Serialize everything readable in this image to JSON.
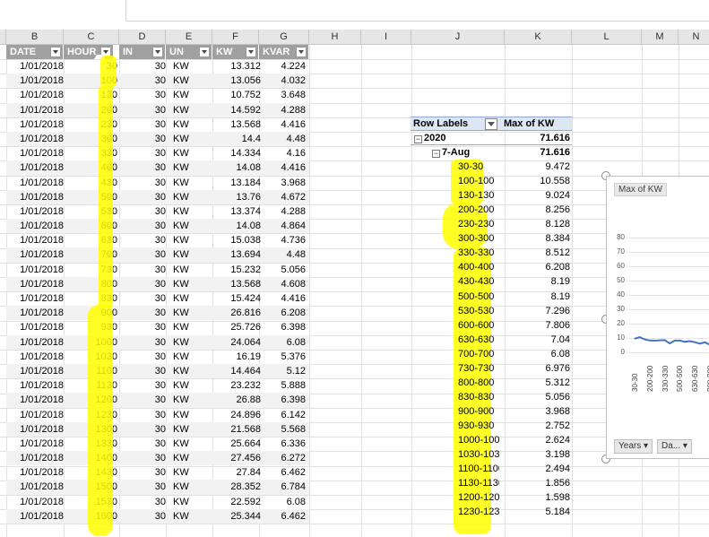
{
  "colors": {
    "header_gray": "#a0a0a0",
    "highlight": "#ffff00",
    "pivot_header": "#dde6f5",
    "line": "#4472c4"
  },
  "columns": [
    "B",
    "C",
    "D",
    "E",
    "F",
    "G",
    "H",
    "I",
    "J",
    "K",
    "L",
    "M",
    "N"
  ],
  "table": {
    "headers": [
      "DATE",
      "HOUR",
      "IN",
      "UN",
      "KW",
      "KVAR"
    ],
    "rows": [
      [
        "1/01/2018",
        "30",
        "30",
        "KW",
        "13.312",
        "4.224"
      ],
      [
        "1/01/2018",
        "100",
        "30",
        "KW",
        "13.056",
        "4.032"
      ],
      [
        "1/01/2018",
        "130",
        "30",
        "KW",
        "10.752",
        "3.648"
      ],
      [
        "1/01/2018",
        "200",
        "30",
        "KW",
        "14.592",
        "4.288"
      ],
      [
        "1/01/2018",
        "230",
        "30",
        "KW",
        "13.568",
        "4.416"
      ],
      [
        "1/01/2018",
        "300",
        "30",
        "KW",
        "14.4",
        "4.48"
      ],
      [
        "1/01/2018",
        "330",
        "30",
        "KW",
        "14.334",
        "4.16"
      ],
      [
        "1/01/2018",
        "400",
        "30",
        "KW",
        "14.08",
        "4.416"
      ],
      [
        "1/01/2018",
        "430",
        "30",
        "KW",
        "13.184",
        "3.968"
      ],
      [
        "1/01/2018",
        "500",
        "30",
        "KW",
        "13.76",
        "4.672"
      ],
      [
        "1/01/2018",
        "530",
        "30",
        "KW",
        "13.374",
        "4.288"
      ],
      [
        "1/01/2018",
        "600",
        "30",
        "KW",
        "14.08",
        "4.864"
      ],
      [
        "1/01/2018",
        "630",
        "30",
        "KW",
        "15.038",
        "4.736"
      ],
      [
        "1/01/2018",
        "700",
        "30",
        "KW",
        "13.694",
        "4.48"
      ],
      [
        "1/01/2018",
        "730",
        "30",
        "KW",
        "15.232",
        "5.056"
      ],
      [
        "1/01/2018",
        "800",
        "30",
        "KW",
        "13.568",
        "4.608"
      ],
      [
        "1/01/2018",
        "830",
        "30",
        "KW",
        "15.424",
        "4.416"
      ],
      [
        "1/01/2018",
        "900",
        "30",
        "KW",
        "26.816",
        "6.208"
      ],
      [
        "1/01/2018",
        "930",
        "30",
        "KW",
        "25.726",
        "6.398"
      ],
      [
        "1/01/2018",
        "1000",
        "30",
        "KW",
        "24.064",
        "6.08"
      ],
      [
        "1/01/2018",
        "1030",
        "30",
        "KW",
        "16.19",
        "5.376"
      ],
      [
        "1/01/2018",
        "1100",
        "30",
        "KW",
        "14.464",
        "5.12"
      ],
      [
        "1/01/2018",
        "1130",
        "30",
        "KW",
        "23.232",
        "5.888"
      ],
      [
        "1/01/2018",
        "1200",
        "30",
        "KW",
        "26.88",
        "6.398"
      ],
      [
        "1/01/2018",
        "1230",
        "30",
        "KW",
        "24.896",
        "6.142"
      ],
      [
        "1/01/2018",
        "1300",
        "30",
        "KW",
        "21.568",
        "5.568"
      ],
      [
        "1/01/2018",
        "1330",
        "30",
        "KW",
        "25.664",
        "6.336"
      ],
      [
        "1/01/2018",
        "1400",
        "30",
        "KW",
        "27.456",
        "6.272"
      ],
      [
        "1/01/2018",
        "1430",
        "30",
        "KW",
        "27.84",
        "6.462"
      ],
      [
        "1/01/2018",
        "1500",
        "30",
        "KW",
        "28.352",
        "6.784"
      ],
      [
        "1/01/2018",
        "1530",
        "30",
        "KW",
        "22.592",
        "6.08"
      ],
      [
        "1/01/2018",
        "1600",
        "30",
        "KW",
        "25.344",
        "6.462"
      ]
    ]
  },
  "pivot": {
    "row_labels": "Row Labels",
    "value_header": "Max of  KW",
    "year": {
      "label": "2020",
      "value": "71.616"
    },
    "month": {
      "label": "7-Aug",
      "value": "71.616"
    },
    "rows": [
      [
        "30-30",
        "9.472"
      ],
      [
        "100-100",
        "10.558"
      ],
      [
        "130-130",
        "9.024"
      ],
      [
        "200-200",
        "8.256"
      ],
      [
        "230-230",
        "8.128"
      ],
      [
        "300-300",
        "8.384"
      ],
      [
        "330-330",
        "8.512"
      ],
      [
        "400-400",
        "6.208"
      ],
      [
        "430-430",
        "8.19"
      ],
      [
        "500-500",
        "8.19"
      ],
      [
        "530-530",
        "7.296"
      ],
      [
        "600-600",
        "7.806"
      ],
      [
        "630-630",
        "7.04"
      ],
      [
        "700-700",
        "6.08"
      ],
      [
        "730-730",
        "6.976"
      ],
      [
        "800-800",
        "5.312"
      ],
      [
        "830-830",
        "5.056"
      ],
      [
        "900-900",
        "3.968"
      ],
      [
        "930-930",
        "2.752"
      ],
      [
        "1000-1000",
        "2.624"
      ],
      [
        "1030-1030",
        "3.198"
      ],
      [
        "1100-1100",
        "2.494"
      ],
      [
        "1130-1130",
        "1.856"
      ],
      [
        "1200-1200",
        "1.598"
      ],
      [
        "1230-1230",
        "5.184"
      ]
    ]
  },
  "chart": {
    "value_button": "Max of  KW",
    "filter_years": "Years",
    "filter_days": "Da..."
  },
  "chart_data": {
    "type": "line",
    "title": "",
    "ylabel": "",
    "ylim": [
      0,
      80
    ],
    "yticks": [
      0,
      10,
      20,
      30,
      40,
      50,
      60,
      70,
      80
    ],
    "x": [
      "30-30",
      "100-100",
      "130-130",
      "200-200",
      "230-230",
      "300-300",
      "330-330",
      "400-400",
      "430-430",
      "500-500",
      "530-530",
      "600-600",
      "630-630",
      "700-700",
      "730-730",
      "800-800",
      "830-830",
      "900-900",
      "930-930"
    ],
    "xticks_shown": [
      "30-30",
      "200-200",
      "330-330",
      "500-500",
      "630-630",
      "800-800",
      "930-930"
    ],
    "series": [
      {
        "values": [
          9.472,
          10.558,
          9.024,
          8.256,
          8.128,
          8.384,
          8.512,
          6.208,
          8.19,
          8.19,
          7.296,
          7.806,
          7.04,
          6.08,
          6.976,
          5.312,
          5.056,
          3.968,
          2.752
        ]
      }
    ],
    "grid": true,
    "legend": "none"
  }
}
